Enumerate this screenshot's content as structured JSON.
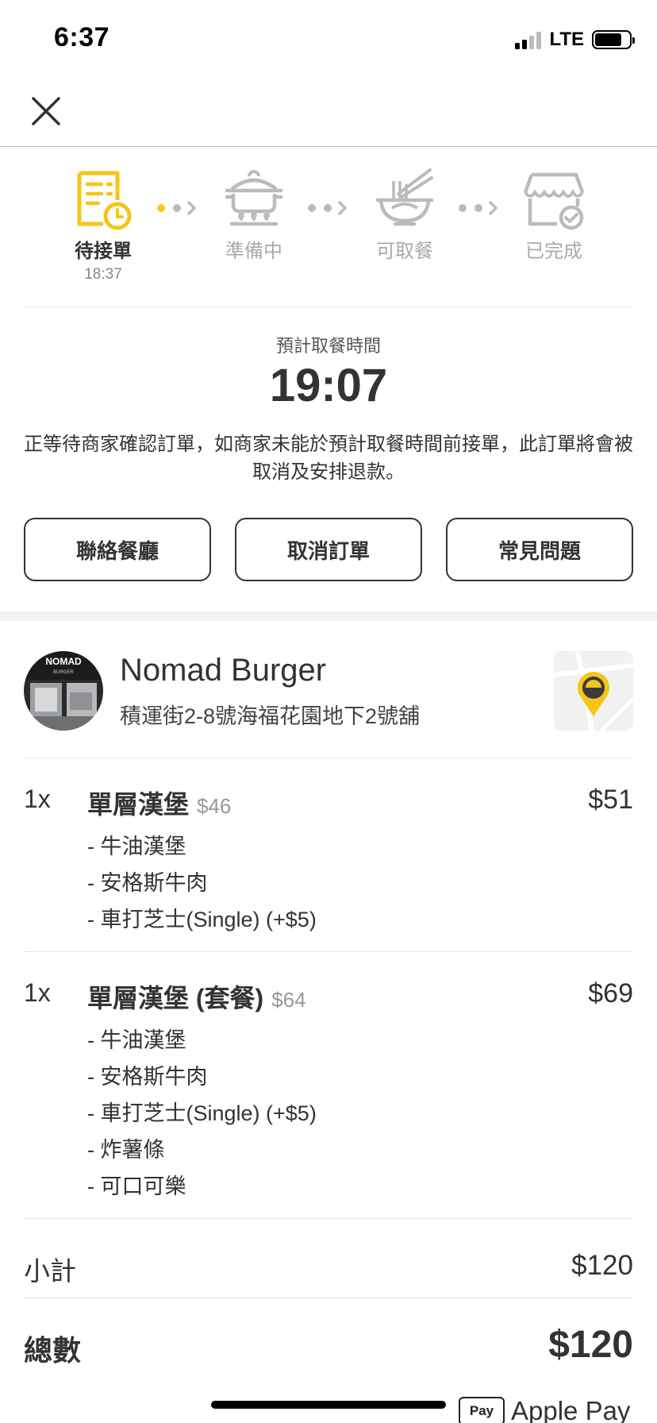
{
  "status_bar": {
    "time": "6:37",
    "network": "LTE",
    "battery_level": 0.78
  },
  "progress": {
    "steps": [
      {
        "label": "待接單",
        "time": "18:37",
        "active": true
      },
      {
        "label": "準備中",
        "active": false
      },
      {
        "label": "可取餐",
        "active": false
      },
      {
        "label": "已完成",
        "active": false
      }
    ]
  },
  "pickup": {
    "label": "預計取餐時間",
    "time": "19:07",
    "note": "正等待商家確認訂單，如商家未能於預計取餐時間前接單，此訂單將會被取消及安排退款。"
  },
  "actions": {
    "contact_label": "聯絡餐廳",
    "cancel_label": "取消訂單",
    "faq_label": "常見問題"
  },
  "restaurant": {
    "name": "Nomad Burger",
    "address": "積運街2-8號海福花園地下2號舖",
    "photo_sign": "NOMAD",
    "photo_sign_sub": "BURGER"
  },
  "items": [
    {
      "qty": "1x",
      "name": "單層漢堡",
      "base_price": "$46",
      "price": "$51",
      "options": [
        "- 牛油漢堡",
        "- 安格斯牛肉",
        "- 車打芝士(Single) (+$5)"
      ]
    },
    {
      "qty": "1x",
      "name": "單層漢堡 (套餐)",
      "base_price": "$64",
      "price": "$69",
      "options": [
        "- 牛油漢堡",
        "- 安格斯牛肉",
        "- 車打芝士(Single) (+$5)",
        "- 炸薯條",
        "- 可口可樂"
      ]
    }
  ],
  "summary": {
    "subtotal_label": "小計",
    "subtotal": "$120",
    "total_label": "總數",
    "total": "$120"
  },
  "payment": {
    "badge": "Pay",
    "method": "Apple Pay"
  },
  "colors": {
    "accent": "#f5c518",
    "text": "#333333",
    "inactive": "#bbbbbb"
  },
  "icons": {
    "close": "close-icon",
    "step1": "order-receipt-clock-icon",
    "step2": "cooking-pot-icon",
    "step3": "noodle-bowl-icon",
    "step4": "shop-check-icon",
    "map": "map-pin-icon"
  }
}
